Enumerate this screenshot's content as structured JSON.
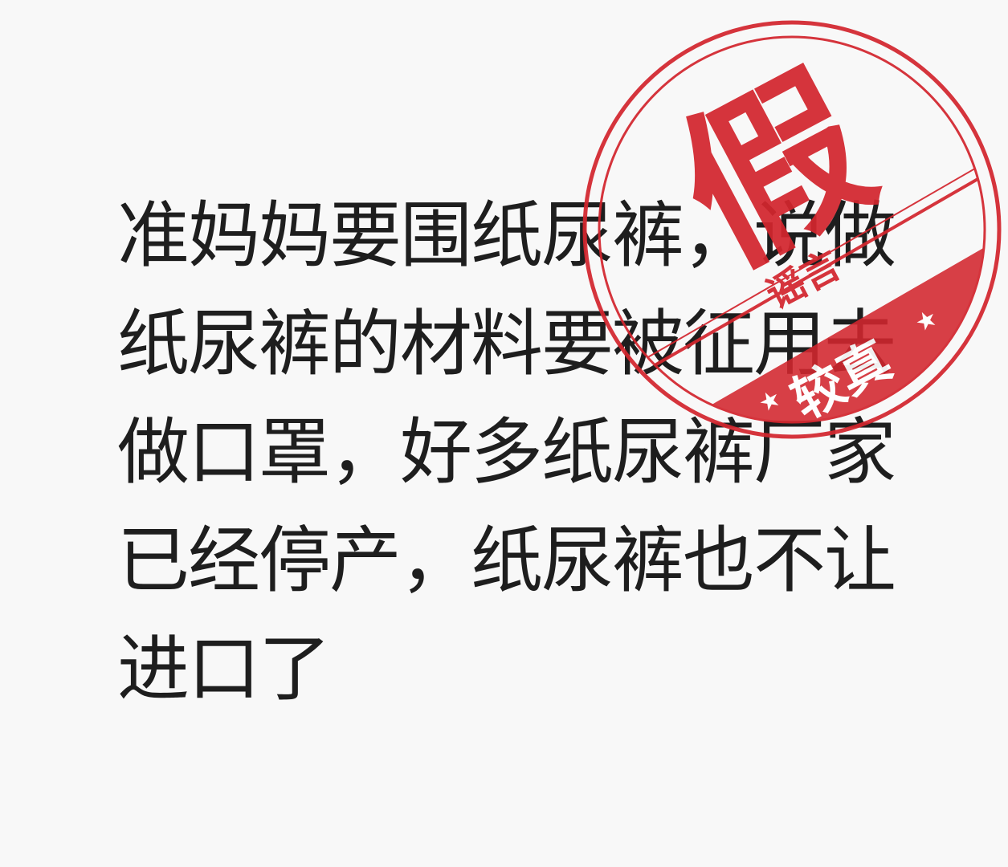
{
  "rumor_text": "准妈妈要围纸尿裤，说做纸尿裤的材料要被征用去做口罩，好多纸尿裤厂家已经停产，纸尿裤也不让进口了",
  "stamp": {
    "verdict": "假",
    "label": "谣言",
    "brand": "较真",
    "color": "#d3262e"
  }
}
